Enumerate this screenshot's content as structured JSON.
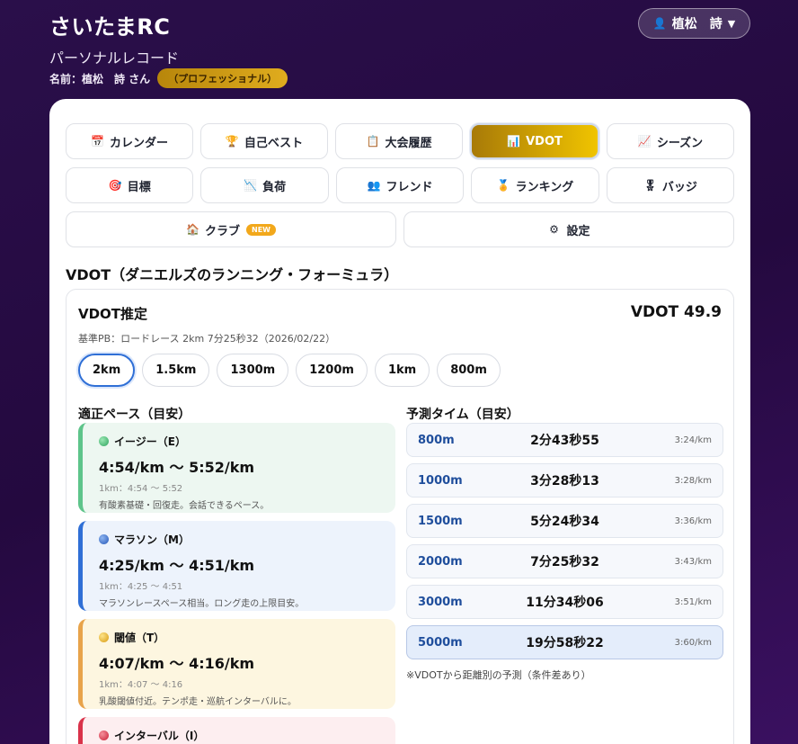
{
  "header": {
    "app_title": "さいたまRC",
    "subtitle": "パーソナルレコード",
    "name_line": "名前：植松　詩 さん",
    "rank_badge": "（プロフェッショナル）",
    "user_button": "植松　詩",
    "user_icon": "person-icon",
    "caret": "▼"
  },
  "nav": {
    "rows": [
      [
        {
          "icon": "📅",
          "label": "カレンダー",
          "name": "tab-calendar"
        },
        {
          "icon": "🏆",
          "label": "自己ベスト",
          "name": "tab-personal-best"
        },
        {
          "icon": "📋",
          "label": "大会履歴",
          "name": "tab-race-history"
        },
        {
          "icon": "📊",
          "label": "VDOT",
          "name": "tab-vdot",
          "active": true
        },
        {
          "icon": "📈",
          "label": "シーズン",
          "name": "tab-season"
        }
      ],
      [
        {
          "icon": "🎯",
          "label": "目標",
          "name": "tab-goal"
        },
        {
          "icon": "📉",
          "label": "負荷",
          "name": "tab-load"
        },
        {
          "icon": "👥",
          "label": "フレンド",
          "name": "tab-friends"
        },
        {
          "icon": "🏅",
          "label": "ランキング",
          "name": "tab-ranking"
        },
        {
          "icon": "🎖",
          "label": "バッジ",
          "name": "tab-badges"
        }
      ],
      [
        {
          "icon": "🏠",
          "label": "クラブ",
          "name": "tab-club",
          "badge": "NEW"
        },
        {
          "icon": "⚙",
          "label": "設定",
          "name": "tab-settings"
        }
      ]
    ]
  },
  "section_title": "VDOT（ダニエルズのランニング・フォーミュラ）",
  "estimate": {
    "title": "VDOT推定",
    "value": "VDOT 49.9",
    "base_pb": "基準PB：ロードレース 2km 7分25秒32（2026/02/22）",
    "distances": [
      "2km",
      "1.5km",
      "1300m",
      "1200m",
      "1km",
      "800m"
    ],
    "selected_distance": "2km"
  },
  "paces": {
    "title": "適正ペース（目安）",
    "items": [
      {
        "label": "イージー（E）",
        "range": "4:54/km 〜 5:52/km",
        "per_1km": "1km：4:54 〜 5:52",
        "desc": "有酸素基礎・回復走。会話できるペース。"
      },
      {
        "label": "マラソン（M）",
        "range": "4:25/km 〜 4:51/km",
        "per_1km": "1km：4:25 〜 4:51",
        "desc": "マラソンレースペース相当。ロング走の上限目安。"
      },
      {
        "label": "閾値（T）",
        "range": "4:07/km 〜 4:16/km",
        "per_1km": "1km：4:07 〜 4:16",
        "desc": "乳酸閾値付近。テンポ走・巡航インターバルに。"
      },
      {
        "label": "インターバル（I）",
        "range": "",
        "per_1km": "",
        "desc": ""
      }
    ]
  },
  "predictions": {
    "title": "予測タイム（目安）",
    "rows": [
      {
        "distance": "800m",
        "time": "2分43秒55",
        "pace": "3:24/km"
      },
      {
        "distance": "1000m",
        "time": "3分28秒13",
        "pace": "3:28/km"
      },
      {
        "distance": "1500m",
        "time": "5分24秒34",
        "pace": "3:36/km"
      },
      {
        "distance": "2000m",
        "time": "7分25秒32",
        "pace": "3:43/km"
      },
      {
        "distance": "3000m",
        "time": "11分34秒06",
        "pace": "3:51/km"
      },
      {
        "distance": "5000m",
        "time": "19分58秒22",
        "pace": "3:60/km",
        "highlight": true
      }
    ],
    "note": "※VDOTから距離別の予測（条件差あり）"
  }
}
